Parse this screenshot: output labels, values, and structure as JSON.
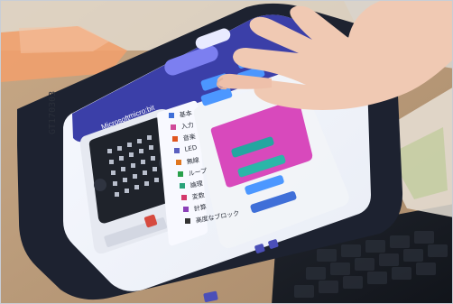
{
  "photo": {
    "sticker_text": "GT170303"
  },
  "screen": {
    "header": {
      "microsoft_label": "Microsoft",
      "microbit_label": "micro:bit"
    },
    "categories": [
      {
        "label": "基本",
        "color": "#3f6fd8"
      },
      {
        "label": "入力",
        "color": "#d04b9a"
      },
      {
        "label": "音楽",
        "color": "#e0561f"
      },
      {
        "label": "LED",
        "color": "#5a5fbf"
      },
      {
        "label": "無線",
        "color": "#e0761f"
      },
      {
        "label": "ループ",
        "color": "#29a04b"
      },
      {
        "label": "論理",
        "color": "#2aa37a"
      },
      {
        "label": "変数",
        "color": "#d4386b"
      },
      {
        "label": "計算",
        "color": "#8b3fb8"
      },
      {
        "label": "高度なブロック",
        "color": "#333333"
      }
    ]
  },
  "colors": {
    "tablet_frame": "#1d2230",
    "header_blue": "#3b3fa8",
    "block_pink": "#d63fb8",
    "block_teal": "#24a6a0",
    "block_blue": "#4c97ff",
    "hand_skin": "#f0c9b3"
  }
}
